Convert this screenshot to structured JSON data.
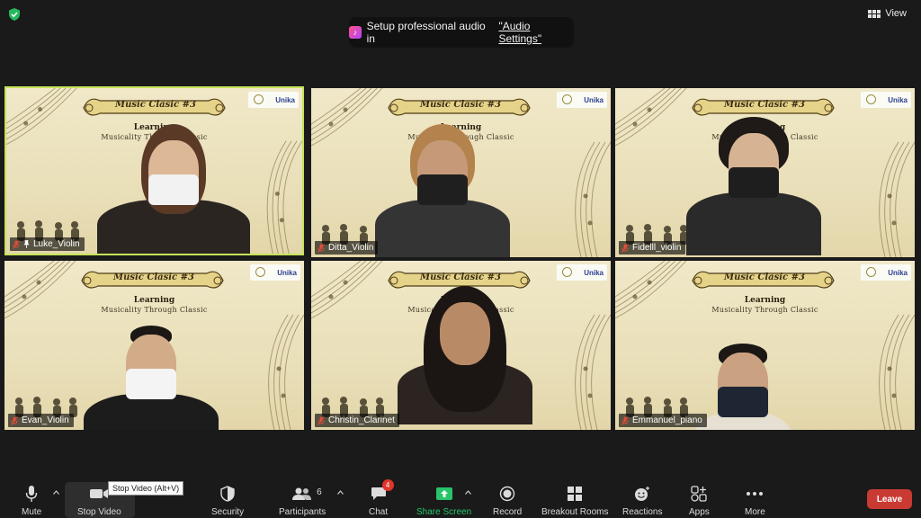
{
  "top": {
    "view_label": "View",
    "notice": {
      "prefix": "Setup professional audio in ",
      "link": "\"Audio Settings\""
    }
  },
  "background": {
    "banner": "Music Clasic #3",
    "sub1": "Learning",
    "sub2": "Musicality Through Classic",
    "logo": "Unika"
  },
  "participants": [
    {
      "name": "Luke_Violin",
      "active": true,
      "muted": true,
      "pinned": true
    },
    {
      "name": "Ditta_Violin",
      "active": false,
      "muted": true
    },
    {
      "name": "Fidelll_violin",
      "active": false,
      "muted": true
    },
    {
      "name": "Evan_Violin",
      "active": false,
      "muted": true
    },
    {
      "name": "Christin_Clarinet",
      "active": false,
      "muted": true
    },
    {
      "name": "Emmanuel_piano",
      "active": false,
      "muted": true
    }
  ],
  "toolbar": {
    "mute": "Mute",
    "stop_video": "Stop Video",
    "tooltip": "Stop Video (Alt+V)",
    "security": "Security",
    "participants": "Participants",
    "participants_count": "6",
    "chat": "Chat",
    "chat_badge": "4",
    "share_screen": "Share Screen",
    "record": "Record",
    "breakout_rooms": "Breakout Rooms",
    "reactions": "Reactions",
    "apps": "Apps",
    "more": "More",
    "leave": "Leave"
  },
  "colors": {
    "active_border": "#c6e45a",
    "share_green": "#27c46a",
    "leave_red": "#c93a33",
    "badge_red": "#e0352b"
  }
}
